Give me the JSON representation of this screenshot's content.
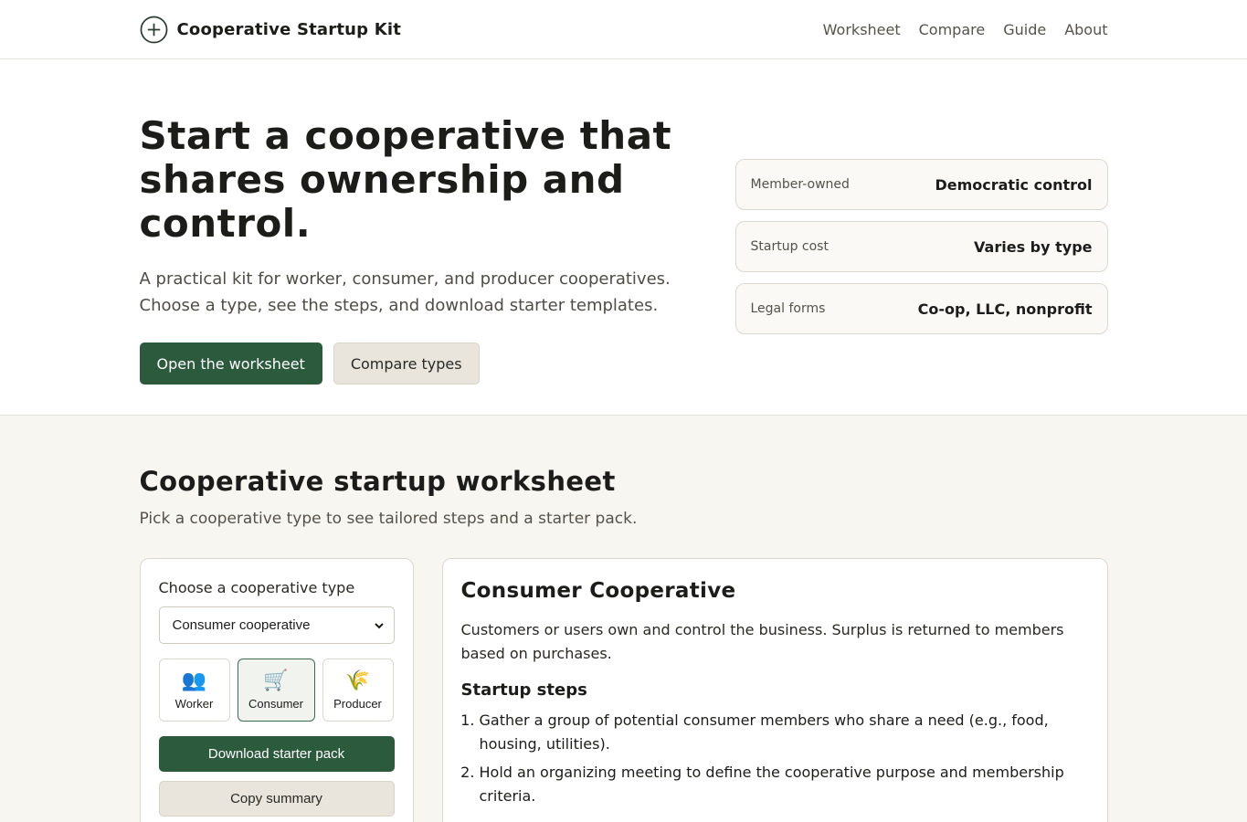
{
  "brand": {
    "name": "Cooperative Startup Kit",
    "icon": "plus-circle-icon"
  },
  "nav": [
    "Worksheet",
    "Compare",
    "Guide",
    "About"
  ],
  "hero": {
    "title": "Start a cooperative that shares ownership and control.",
    "subtitle": "A practical kit for worker, consumer, and producer cooperatives. Choose a type, see the steps, and download starter templates.",
    "primary_cta": "Open the worksheet",
    "secondary_cta": "Compare types",
    "stats": [
      {
        "label": "Member-owned",
        "value": "Democratic control"
      },
      {
        "label": "Startup cost",
        "value": "Varies by type"
      },
      {
        "label": "Legal forms",
        "value": "Co-op, LLC, nonprofit"
      }
    ]
  },
  "worksheet": {
    "title": "Cooperative startup worksheet",
    "subtitle": "Pick a cooperative type to see tailored steps and a starter pack.",
    "choose_label": "Choose a cooperative type",
    "select_value": "Consumer cooperative",
    "types": [
      {
        "label": "Worker",
        "icon": "people-icon",
        "glyph": "👥",
        "active": false
      },
      {
        "label": "Consumer",
        "icon": "shopping-cart-icon",
        "glyph": "🛒",
        "active": true
      },
      {
        "label": "Producer",
        "icon": "wheat-icon",
        "glyph": "🌾",
        "active": false
      }
    ],
    "download_label": "Download starter pack",
    "copy_label": "Copy summary"
  },
  "detail": {
    "title": "Consumer Cooperative",
    "description": "Customers or users own and control the business. Surplus is returned to members based on purchases.",
    "steps_title": "Startup steps",
    "steps": [
      "Gather a group of potential consumer members who share a need (e.g., food, housing, utilities).",
      "Hold an organizing meeting to define the cooperative purpose and membership criteria."
    ]
  },
  "colors": {
    "accent": "#2c5a3d",
    "section_bg": "#f8f6f1",
    "secondary_btn": "#e9e5dc"
  }
}
